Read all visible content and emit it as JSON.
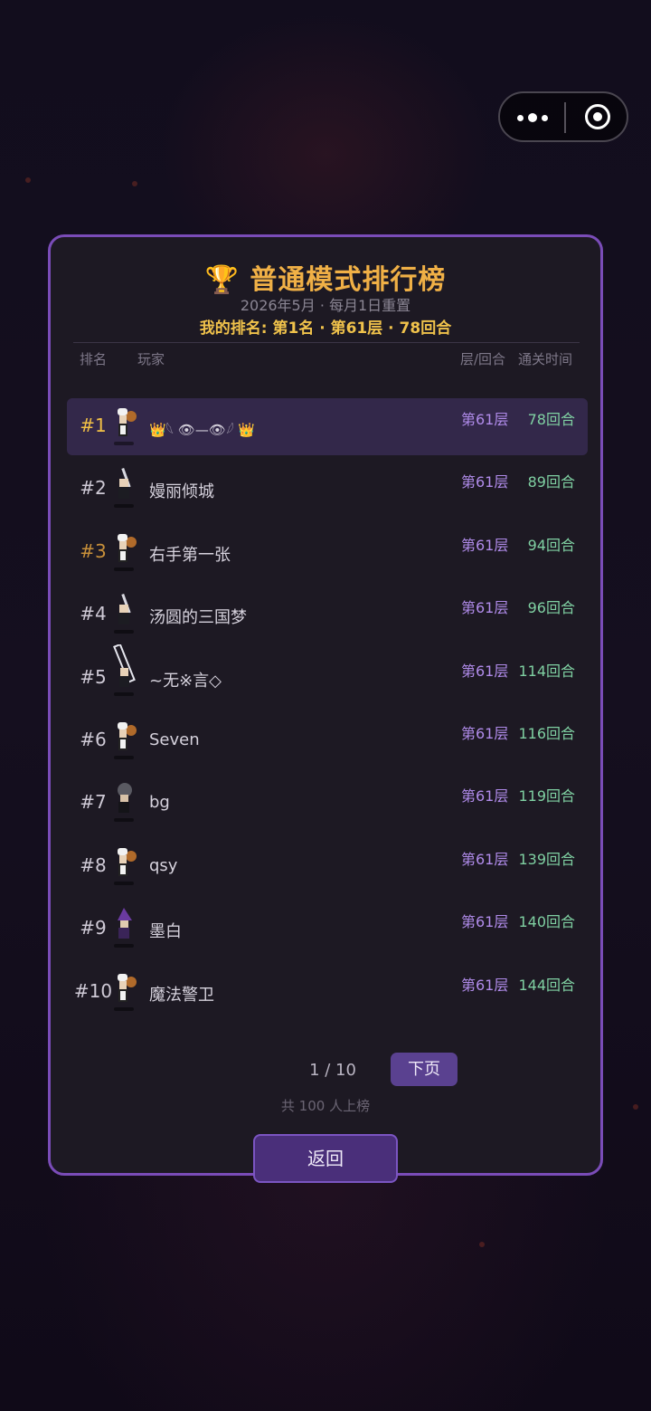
{
  "capsule": {
    "more_icon": "more-dots-icon",
    "close_icon": "target-close-icon"
  },
  "leaderboard": {
    "title": "普通模式排行榜",
    "trophy": "🏆",
    "subtitle": "2026年5月 · 每月1日重置",
    "my_rank": "我的排名: 第1名 · 第61层 · 78回合",
    "headers": {
      "rank": "排名",
      "player": "玩家",
      "floor_turns": "层/回合",
      "clear_time": "通关时间"
    },
    "rows": [
      {
        "rank": "#1",
        "name": "👑𓆩 👁—👁𓆪 👑",
        "floor": "第61层",
        "turns": "78回合",
        "avatar": "chef"
      },
      {
        "rank": "#2",
        "name": "嫚丽倾城",
        "floor": "第61层",
        "turns": "89回合",
        "avatar": "swordsman"
      },
      {
        "rank": "#3",
        "name": "右手第一张",
        "floor": "第61层",
        "turns": "94回合",
        "avatar": "chef"
      },
      {
        "rank": "#4",
        "name": "汤圆的三国梦",
        "floor": "第61层",
        "turns": "96回合",
        "avatar": "swordsman"
      },
      {
        "rank": "#5",
        "name": "~无※言◇",
        "floor": "第61层",
        "turns": "114回合",
        "avatar": "greatsword"
      },
      {
        "rank": "#6",
        "name": "Seven",
        "floor": "第61层",
        "turns": "116回合",
        "avatar": "chef"
      },
      {
        "rank": "#7",
        "name": "bg",
        "floor": "第61层",
        "turns": "119回合",
        "avatar": "rogue"
      },
      {
        "rank": "#8",
        "name": "qsy",
        "floor": "第61层",
        "turns": "139回合",
        "avatar": "chef"
      },
      {
        "rank": "#9",
        "name": "墨白",
        "floor": "第61层",
        "turns": "140回合",
        "avatar": "mage"
      },
      {
        "rank": "#10",
        "name": "魔法警卫",
        "floor": "第61层",
        "turns": "144回合",
        "avatar": "chef"
      }
    ],
    "rank_colors": {
      "first": "#f2c046",
      "third": "#c8903a",
      "default": "#cfcad6"
    },
    "pager": {
      "current": "1 / 10",
      "next_label": "下页",
      "total": "共 100 人上榜"
    },
    "back_label": "返回"
  }
}
